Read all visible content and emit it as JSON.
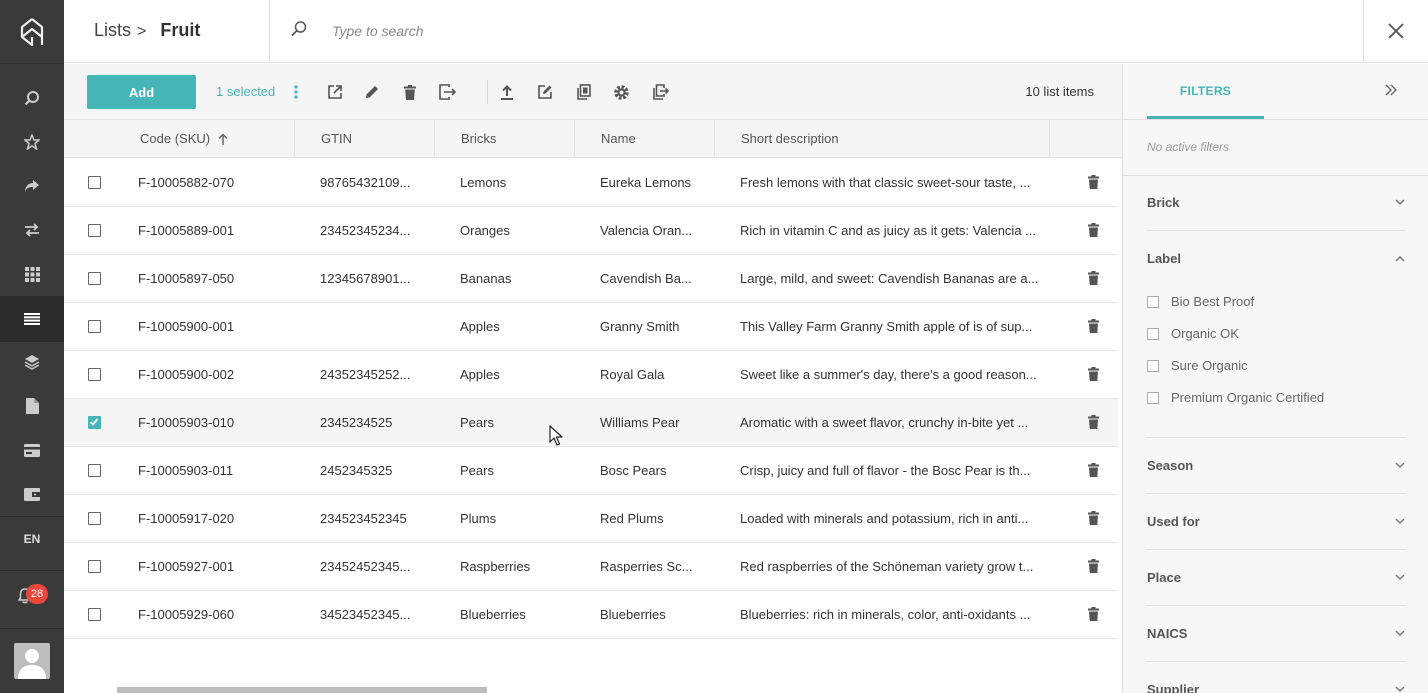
{
  "nav": {
    "items": [
      "search-icon",
      "star-icon",
      "share-icon",
      "transfer-icon",
      "grid-icon",
      "list-icon",
      "layers-icon",
      "document-icon",
      "card-icon",
      "wallet-icon"
    ],
    "language": "EN",
    "notifications": "28"
  },
  "header": {
    "breadcrumb_parent": "Lists",
    "breadcrumb_sep": ">",
    "title": "Fruit",
    "search_placeholder": "Type to search"
  },
  "toolbar": {
    "add_label": "Add",
    "selected_label": "1 selected",
    "count_label": "10 list items"
  },
  "table": {
    "columns": [
      "Code (SKU)",
      "GTIN",
      "Bricks",
      "Name",
      "Short description"
    ],
    "sort_icon": "arrow-up-icon",
    "rows": [
      {
        "checked": false,
        "sku": "F-10005882-070",
        "gtin": "98765432109...",
        "brick": "Lemons",
        "name": "Eureka Lemons",
        "desc": "Fresh lemons with that classic sweet-sour taste, ..."
      },
      {
        "checked": false,
        "sku": "F-10005889-001",
        "gtin": "23452345234...",
        "brick": "Oranges",
        "name": "Valencia Oran...",
        "desc": "Rich in vitamin C and as juicy as it gets: Valencia ..."
      },
      {
        "checked": false,
        "sku": "F-10005897-050",
        "gtin": "12345678901...",
        "brick": "Bananas",
        "name": "Cavendish Ba...",
        "desc": "Large, mild, and sweet: Cavendish Bananas are a..."
      },
      {
        "checked": false,
        "sku": "F-10005900-001",
        "gtin": "",
        "brick": "Apples",
        "name": "Granny Smith",
        "desc": "This Valley Farm Granny Smith apple of is of sup..."
      },
      {
        "checked": false,
        "sku": "F-10005900-002",
        "gtin": "24352345252...",
        "brick": "Apples",
        "name": "Royal Gala",
        "desc": "Sweet like a summer's day, there's a good reason..."
      },
      {
        "checked": true,
        "sku": "F-10005903-010",
        "gtin": "2345234525",
        "brick": "Pears",
        "name": "Williams Pear",
        "desc": "Aromatic with a sweet flavor, crunchy in-bite yet ..."
      },
      {
        "checked": false,
        "sku": "F-10005903-011",
        "gtin": "2452345325",
        "brick": "Pears",
        "name": "Bosc Pears",
        "desc": "Crisp, juicy and full of flavor - the Bosc Pear is th..."
      },
      {
        "checked": false,
        "sku": "F-10005917-020",
        "gtin": "234523452345",
        "brick": "Plums",
        "name": "Red Plums",
        "desc": "Loaded with minerals and potassium, rich in anti..."
      },
      {
        "checked": false,
        "sku": "F-10005927-001",
        "gtin": "23452452345...",
        "brick": "Raspberries",
        "name": "Rasperries Sc...",
        "desc": "Red raspberries of the Schöneman variety grow t..."
      },
      {
        "checked": false,
        "sku": "F-10005929-060",
        "gtin": "34523452345...",
        "brick": "Blueberries",
        "name": "Blueberries",
        "desc": "Blueberries: rich in minerals, color, anti-oxidants ..."
      }
    ]
  },
  "filters": {
    "tab_label": "FILTERS",
    "no_active": "No active filters",
    "sections": [
      "Brick",
      "Label",
      "Season",
      "Used for",
      "Place",
      "NAICS",
      "Supplier"
    ],
    "label_options": [
      "Bio Best Proof",
      "Organic OK",
      "Sure Organic",
      "Premium Organic Certified"
    ]
  },
  "colors": {
    "accent": "#45b5b8",
    "nav_bg": "#3a3a3a",
    "badge": "#e8473c"
  }
}
